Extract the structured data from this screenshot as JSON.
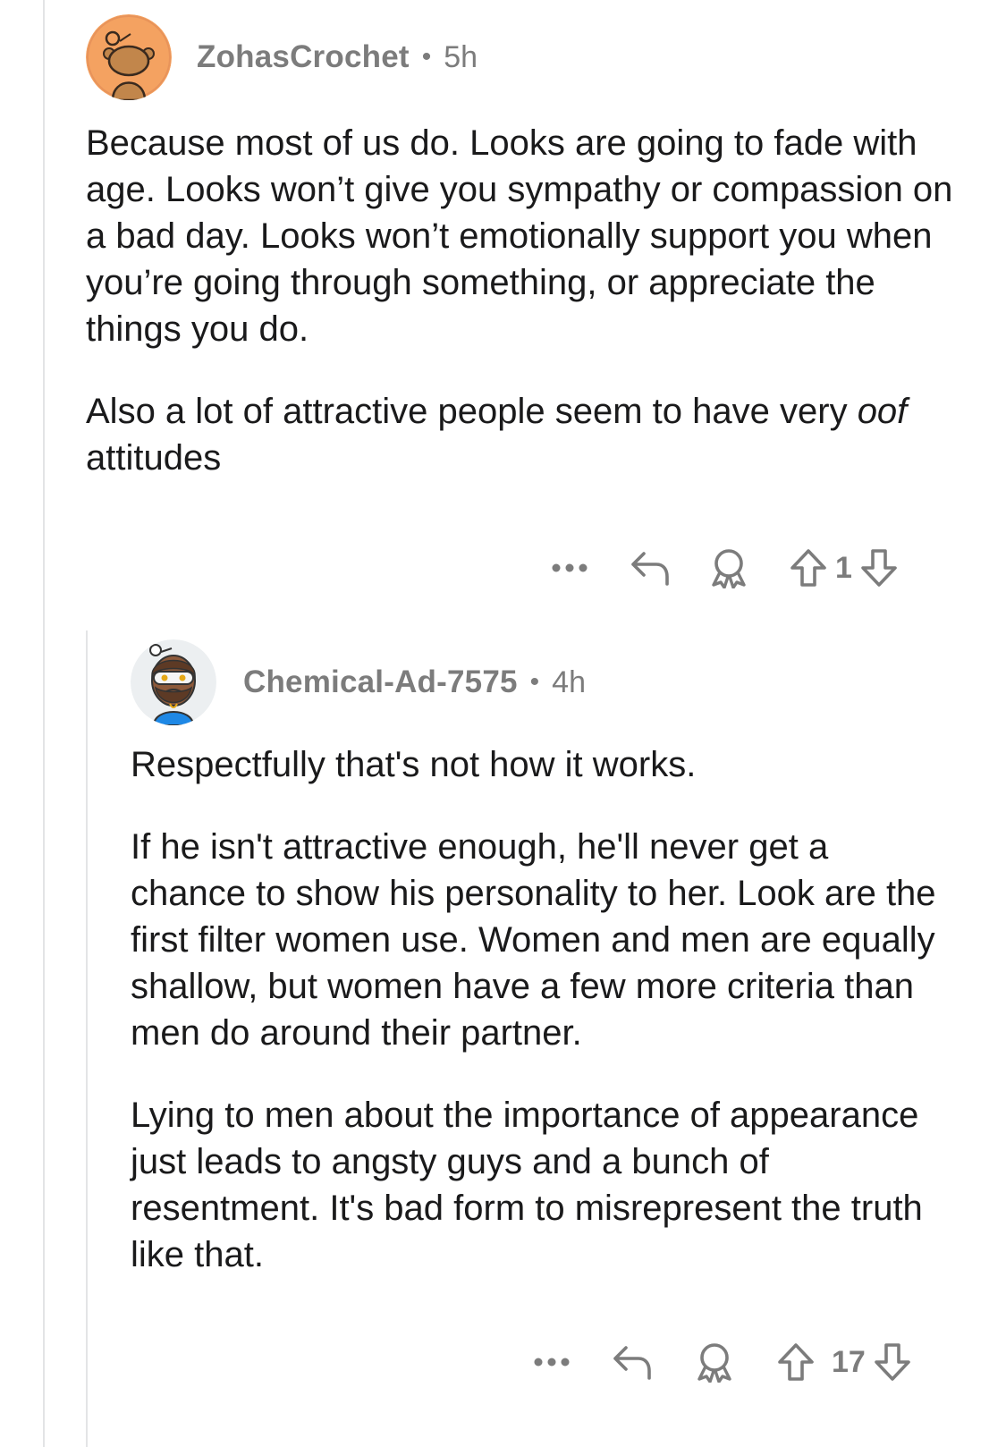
{
  "comments": [
    {
      "author": "ZohasCrochet",
      "separator": "•",
      "time": "5h",
      "paragraphs": [
        "Because most of us do. Looks are going to fade with age. Looks won’t give you sympathy or compassion on a bad day. Looks won’t emotionally support you when you’re going through something, or appreciate the things you do."
      ],
      "last_paragraph_italic": "oof",
      "last_paragraph_before": "Also a lot of attractive people seem to have very ",
      "last_paragraph_after": " attitudes",
      "score": "1"
    },
    {
      "author": "Chemical-Ad-7575",
      "separator": "•",
      "time": "4h",
      "paragraphs": [
        "Respectfully that's not how it works.",
        "If he isn't attractive enough, he'll never get a chance to show his personality to her. Look are the first filter women use. Women and men are equally shallow, but women have a few more criteria than men do around their partner.",
        "Lying to men about the importance of appearance just leads to angsty guys and a bunch of resentment. It's bad form to misrepresent the truth like that."
      ],
      "score": "17"
    }
  ],
  "icons": {
    "more": "more-icon",
    "reply": "reply-icon",
    "award": "award-icon",
    "upvote": "upvote-icon",
    "downvote": "downvote-icon"
  },
  "colors": {
    "text": "#1a1a1b",
    "meta": "#7c7c7c",
    "avatar1_bg": "#f4a261",
    "thread_line": "#e3e4e6"
  }
}
